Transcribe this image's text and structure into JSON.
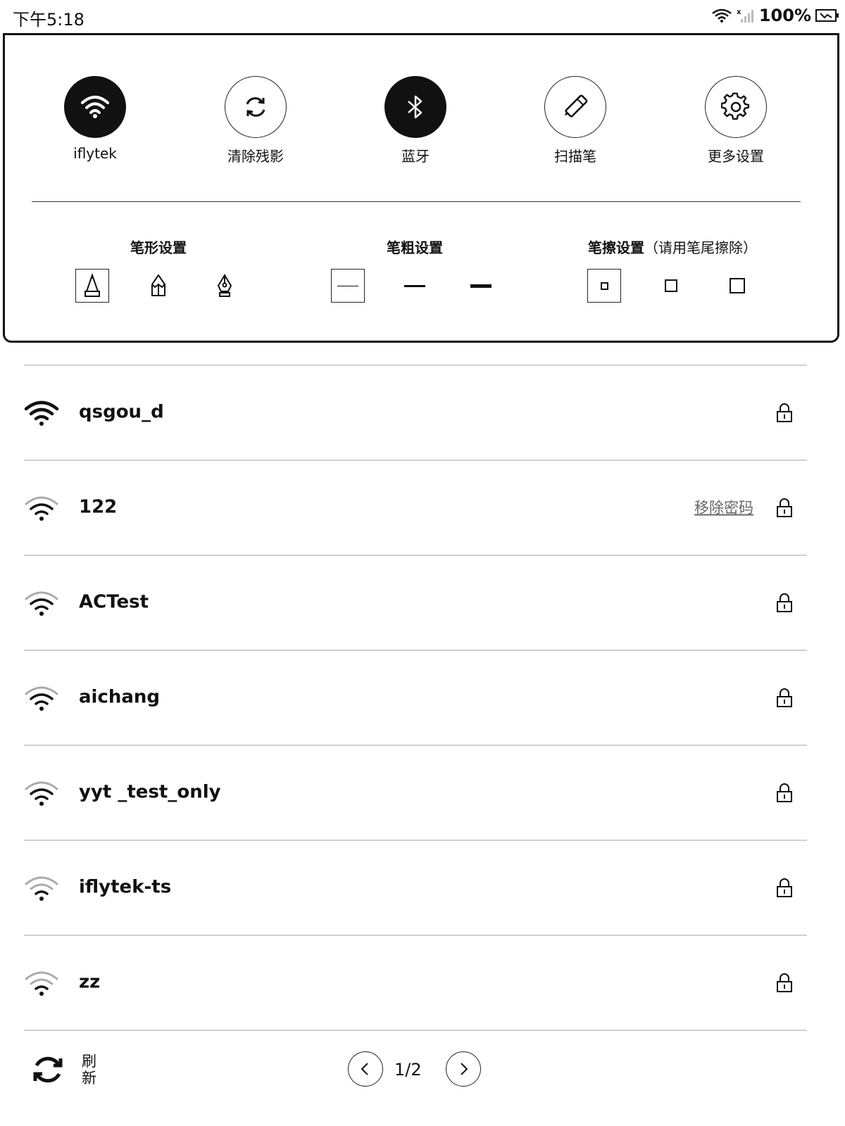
{
  "status_bar": {
    "time": "下午5:18",
    "battery": "100%"
  },
  "quick_settings": {
    "tiles": [
      {
        "label": "iflytek",
        "icon": "wifi-icon",
        "active": true
      },
      {
        "label": "清除残影",
        "icon": "refresh-icon",
        "active": false
      },
      {
        "label": "蓝牙",
        "icon": "bluetooth-icon",
        "active": true
      },
      {
        "label": "扫描笔",
        "icon": "scan-pen-icon",
        "active": false
      },
      {
        "label": "更多设置",
        "icon": "gear-icon",
        "active": false
      }
    ],
    "pen_shape": {
      "title": "笔形设置"
    },
    "pen_width": {
      "title": "笔粗设置"
    },
    "eraser": {
      "title": "笔擦设置",
      "hint": "（请用笔尾擦除）"
    }
  },
  "wifi_list": [
    {
      "ssid": "qsgou_d",
      "signal": 4,
      "locked": true,
      "action": ""
    },
    {
      "ssid": "122",
      "signal": 3,
      "locked": true,
      "action": "移除密码"
    },
    {
      "ssid": "ACTest",
      "signal": 3,
      "locked": true,
      "action": ""
    },
    {
      "ssid": "aichang",
      "signal": 3,
      "locked": true,
      "action": ""
    },
    {
      "ssid": "yyt _test_only",
      "signal": 3,
      "locked": true,
      "action": ""
    },
    {
      "ssid": "iflytek-ts",
      "signal": 2,
      "locked": true,
      "action": ""
    },
    {
      "ssid": "zz",
      "signal": 2,
      "locked": true,
      "action": ""
    }
  ],
  "footer": {
    "refresh_label": "刷新",
    "page": "1/2"
  }
}
